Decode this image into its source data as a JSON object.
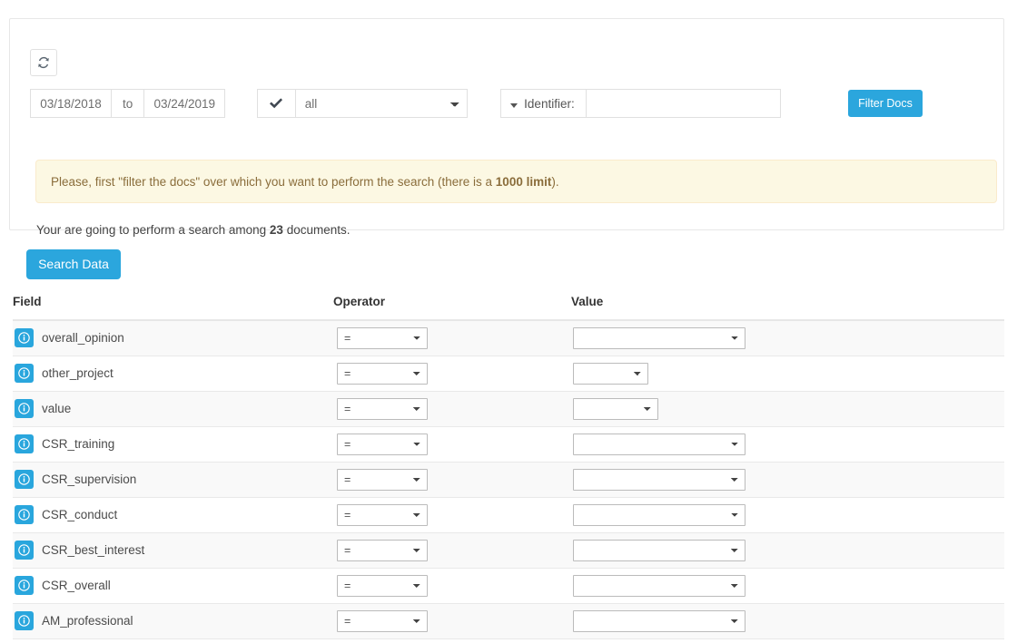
{
  "filter_panel": {
    "refresh_icon": "refresh-icon",
    "date_from": "03/18/2018",
    "date_to_label": "to",
    "date_to": "03/24/2019",
    "status_icon": "check-icon",
    "status_selected": "all",
    "status_options": [
      "all"
    ],
    "identifier_label": "Identifier:",
    "identifier_caret_icon": "caret-down-icon",
    "identifier_value": "",
    "identifier_placeholder": "",
    "filter_button": "Filter Docs",
    "accent_color": "#2ba6dd"
  },
  "alert": {
    "text_before": "Please, first \"filter the docs\" over which you want to perform the search (there is a ",
    "limit": "1000 limit",
    "text_after": ").",
    "bg_color": "#fcf8e3",
    "text_color": "#8a6d3b"
  },
  "summary": {
    "text_before": "Your are going to perform a search among ",
    "count": "23",
    "text_after": " documents."
  },
  "search": {
    "button_label": "Search Data"
  },
  "table": {
    "headers": {
      "field": "Field",
      "operator": "Operator",
      "value": "Value"
    },
    "rows": [
      {
        "info_icon": "info-icon",
        "field": "overall_opinion",
        "operator": "=",
        "operator_options": [
          "=",
          "!=",
          ">",
          "<"
        ],
        "value": "",
        "value_options": [
          ""
        ],
        "value_width": 190
      },
      {
        "info_icon": "info-icon",
        "field": "other_project",
        "operator": "=",
        "operator_options": [
          "=",
          "!=",
          ">",
          "<"
        ],
        "value": "",
        "value_options": [
          ""
        ],
        "value_width": 83
      },
      {
        "info_icon": "info-icon",
        "field": "value",
        "operator": "=",
        "operator_options": [
          "=",
          "!=",
          ">",
          "<"
        ],
        "value": "",
        "value_options": [
          ""
        ],
        "value_width": 94
      },
      {
        "info_icon": "info-icon",
        "field": "CSR_training",
        "operator": "=",
        "operator_options": [
          "=",
          "!=",
          ">",
          "<"
        ],
        "value": "",
        "value_options": [
          ""
        ],
        "value_width": 190
      },
      {
        "info_icon": "info-icon",
        "field": "CSR_supervision",
        "operator": "=",
        "operator_options": [
          "=",
          "!=",
          ">",
          "<"
        ],
        "value": "",
        "value_options": [
          ""
        ],
        "value_width": 190
      },
      {
        "info_icon": "info-icon",
        "field": "CSR_conduct",
        "operator": "=",
        "operator_options": [
          "=",
          "!=",
          ">",
          "<"
        ],
        "value": "",
        "value_options": [
          ""
        ],
        "value_width": 190
      },
      {
        "info_icon": "info-icon",
        "field": "CSR_best_interest",
        "operator": "=",
        "operator_options": [
          "=",
          "!=",
          ">",
          "<"
        ],
        "value": "",
        "value_options": [
          ""
        ],
        "value_width": 190
      },
      {
        "info_icon": "info-icon",
        "field": "CSR_overall",
        "operator": "=",
        "operator_options": [
          "=",
          "!=",
          ">",
          "<"
        ],
        "value": "",
        "value_options": [
          ""
        ],
        "value_width": 190
      },
      {
        "info_icon": "info-icon",
        "field": "AM_professional",
        "operator": "=",
        "operator_options": [
          "=",
          "!=",
          ">",
          "<"
        ],
        "value": "",
        "value_options": [
          ""
        ],
        "value_width": 190
      }
    ]
  }
}
